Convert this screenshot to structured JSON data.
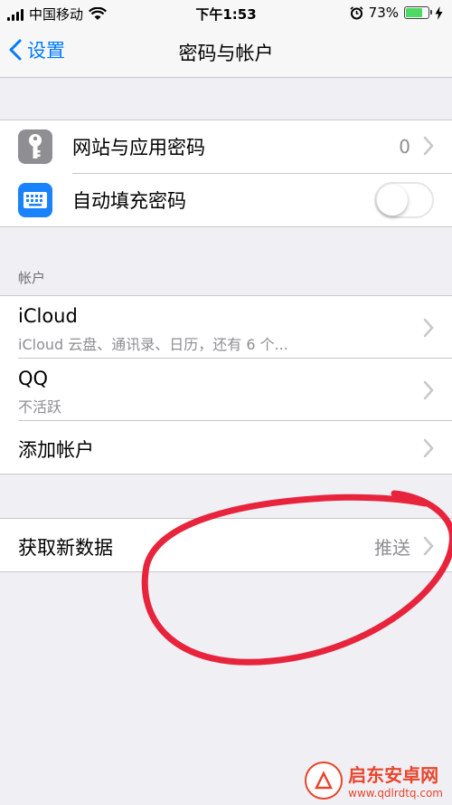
{
  "status_bar": {
    "carrier": "中国移动",
    "time": "下午1:53",
    "battery_percent": "73%",
    "battery_level": 0.73,
    "icons": [
      "signal-icon",
      "wifi-icon",
      "alarm-icon",
      "battery-icon",
      "charging-icon"
    ]
  },
  "nav": {
    "back_label": "设置",
    "title": "密码与帐户"
  },
  "passwords": {
    "websites_label": "网站与应用密码",
    "websites_count": "0",
    "autofill_label": "自动填充密码",
    "autofill_on": false
  },
  "accounts": {
    "header": "帐户",
    "items": [
      {
        "title": "iCloud",
        "subtitle": "iCloud 云盘、通讯录、日历，还有 6 个..."
      },
      {
        "title": "QQ",
        "subtitle": "不活跃"
      }
    ],
    "add_label": "添加帐户"
  },
  "fetch": {
    "label": "获取新数据",
    "value": "推送"
  },
  "watermark": {
    "name": "启东安卓网",
    "url": "www.qdlrdtq.com"
  },
  "colors": {
    "accent": "#007aff",
    "annotation": "#e8243c",
    "switch_off": "#e5e5ea"
  }
}
